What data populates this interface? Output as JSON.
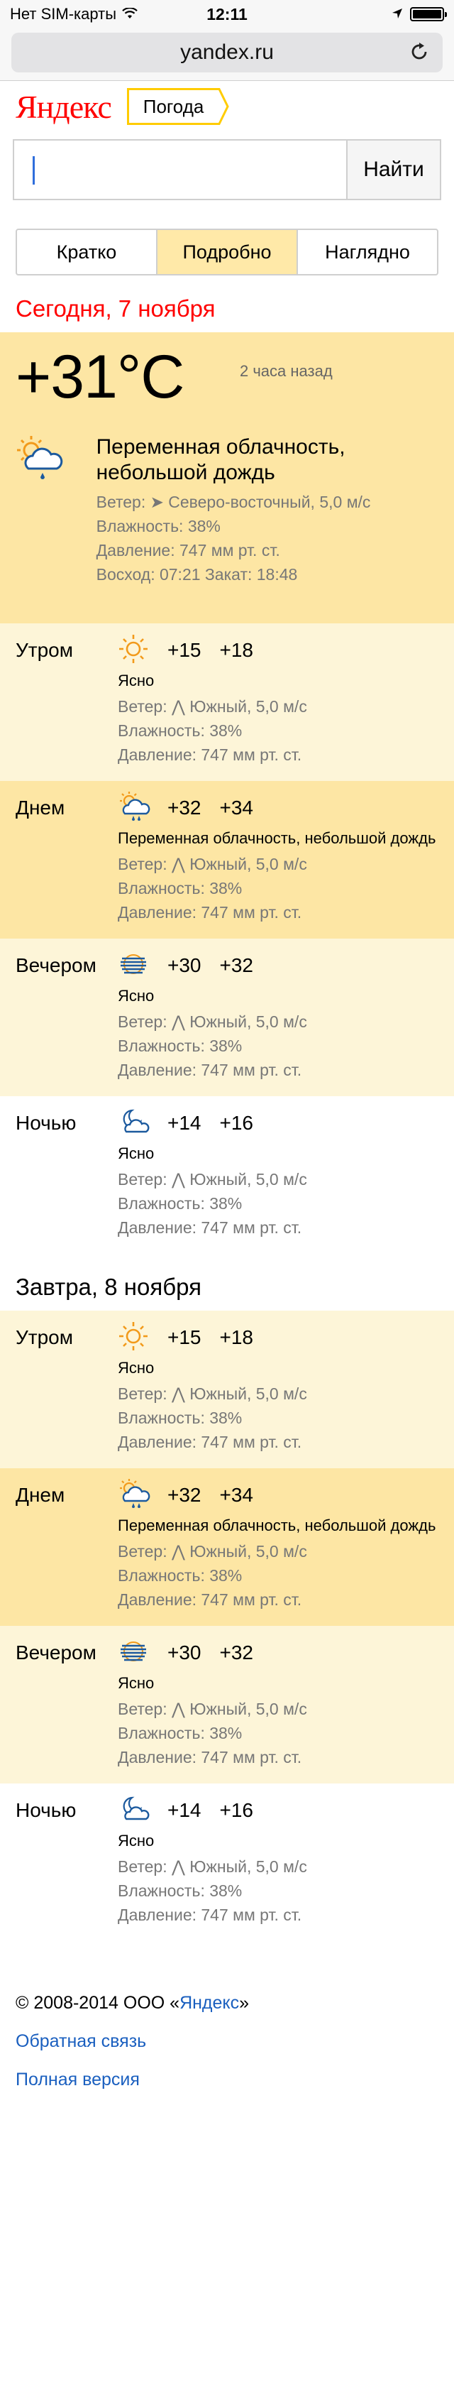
{
  "status_bar": {
    "carrier": "Нет SIM-карты",
    "time": "12:11"
  },
  "browser": {
    "url": "yandex.ru"
  },
  "header": {
    "logo": "Яндекс",
    "service_tag": "Погода"
  },
  "search": {
    "value": "",
    "button": "Найти"
  },
  "tabs": [
    {
      "label": "Кратко"
    },
    {
      "label": "Подробно",
      "active": true
    },
    {
      "label": "Наглядно"
    }
  ],
  "today": {
    "title": "Сегодня, 7 ноября",
    "current": {
      "temp": "+31°C",
      "updated": "2 часа назад",
      "icon": "partly-cloudy-light-rain-icon",
      "desc": "Переменная облачность, небольшой дождь",
      "wind": "Ветер: ➤ Северо-восточный, 5,0 м/с",
      "humidity": "Влажность: 38%",
      "pressure": "Давление: 747 мм рт. ст.",
      "sun": "Восход: 07:21   Закат: 18:48"
    },
    "parts": [
      {
        "name": "Утром",
        "icon": "sun-icon",
        "t1": "+15",
        "t2": "+18",
        "desc": "Ясно",
        "wind": "Ветер: ⋀ Южный, 5,0 м/с",
        "humidity": "Влажность: 38%",
        "pressure": "Давление: 747 мм рт. ст."
      },
      {
        "name": "Днем",
        "icon": "partly-cloudy-rain-icon",
        "t1": "+32",
        "t2": "+34",
        "desc": "Переменная облачность, небольшой дождь",
        "wind": "Ветер: ⋀ Южный, 5,0 м/с",
        "humidity": "Влажность: 38%",
        "pressure": "Давление: 747 мм рт. ст."
      },
      {
        "name": "Вечером",
        "icon": "fog-icon",
        "t1": "+30",
        "t2": "+32",
        "desc": "Ясно",
        "wind": "Ветер: ⋀ Южный, 5,0 м/с",
        "humidity": "Влажность: 38%",
        "pressure": "Давление: 747 мм рт. ст."
      },
      {
        "name": "Ночью",
        "icon": "moon-cloud-icon",
        "t1": "+14",
        "t2": "+16",
        "desc": "Ясно",
        "wind": "Ветер: ⋀ Южный, 5,0 м/с",
        "humidity": "Влажность: 38%",
        "pressure": "Давление: 747 мм рт. ст."
      }
    ]
  },
  "tomorrow": {
    "title": "Завтра, 8 ноября",
    "parts": [
      {
        "name": "Утром",
        "icon": "sun-icon",
        "t1": "+15",
        "t2": "+18",
        "desc": "Ясно",
        "wind": "Ветер: ⋀ Южный, 5,0 м/с",
        "humidity": "Влажность: 38%",
        "pressure": "Давление: 747 мм рт. ст."
      },
      {
        "name": "Днем",
        "icon": "partly-cloudy-rain-icon",
        "t1": "+32",
        "t2": "+34",
        "desc": "Переменная облачность, небольшой дождь",
        "wind": "Ветер: ⋀ Южный, 5,0 м/с",
        "humidity": "Влажность: 38%",
        "pressure": "Давление: 747 мм рт. ст."
      },
      {
        "name": "Вечером",
        "icon": "fog-icon",
        "t1": "+30",
        "t2": "+32",
        "desc": "Ясно",
        "wind": "Ветер: ⋀ Южный, 5,0 м/с",
        "humidity": "Влажность: 38%",
        "pressure": "Давление: 747 мм рт. ст."
      },
      {
        "name": "Ночью",
        "icon": "moon-cloud-icon",
        "t1": "+14",
        "t2": "+16",
        "desc": "Ясно",
        "wind": "Ветер: ⋀ Южный, 5,0 м/с",
        "humidity": "Влажность: 38%",
        "pressure": "Давление: 747 мм рт. ст."
      }
    ]
  },
  "footer": {
    "copyright_prefix": "© 2008-2014  ООО «",
    "copyright_link": "Яндекс",
    "copyright_suffix": "»",
    "feedback": "Обратная связь",
    "full_version": "Полная версия"
  },
  "colors": {
    "accent_red": "#ff0000",
    "tag_border": "#ffcc00",
    "panel_dark": "#fde6a4",
    "panel_light": "#fdf5d8",
    "link": "#1a5fbf"
  }
}
